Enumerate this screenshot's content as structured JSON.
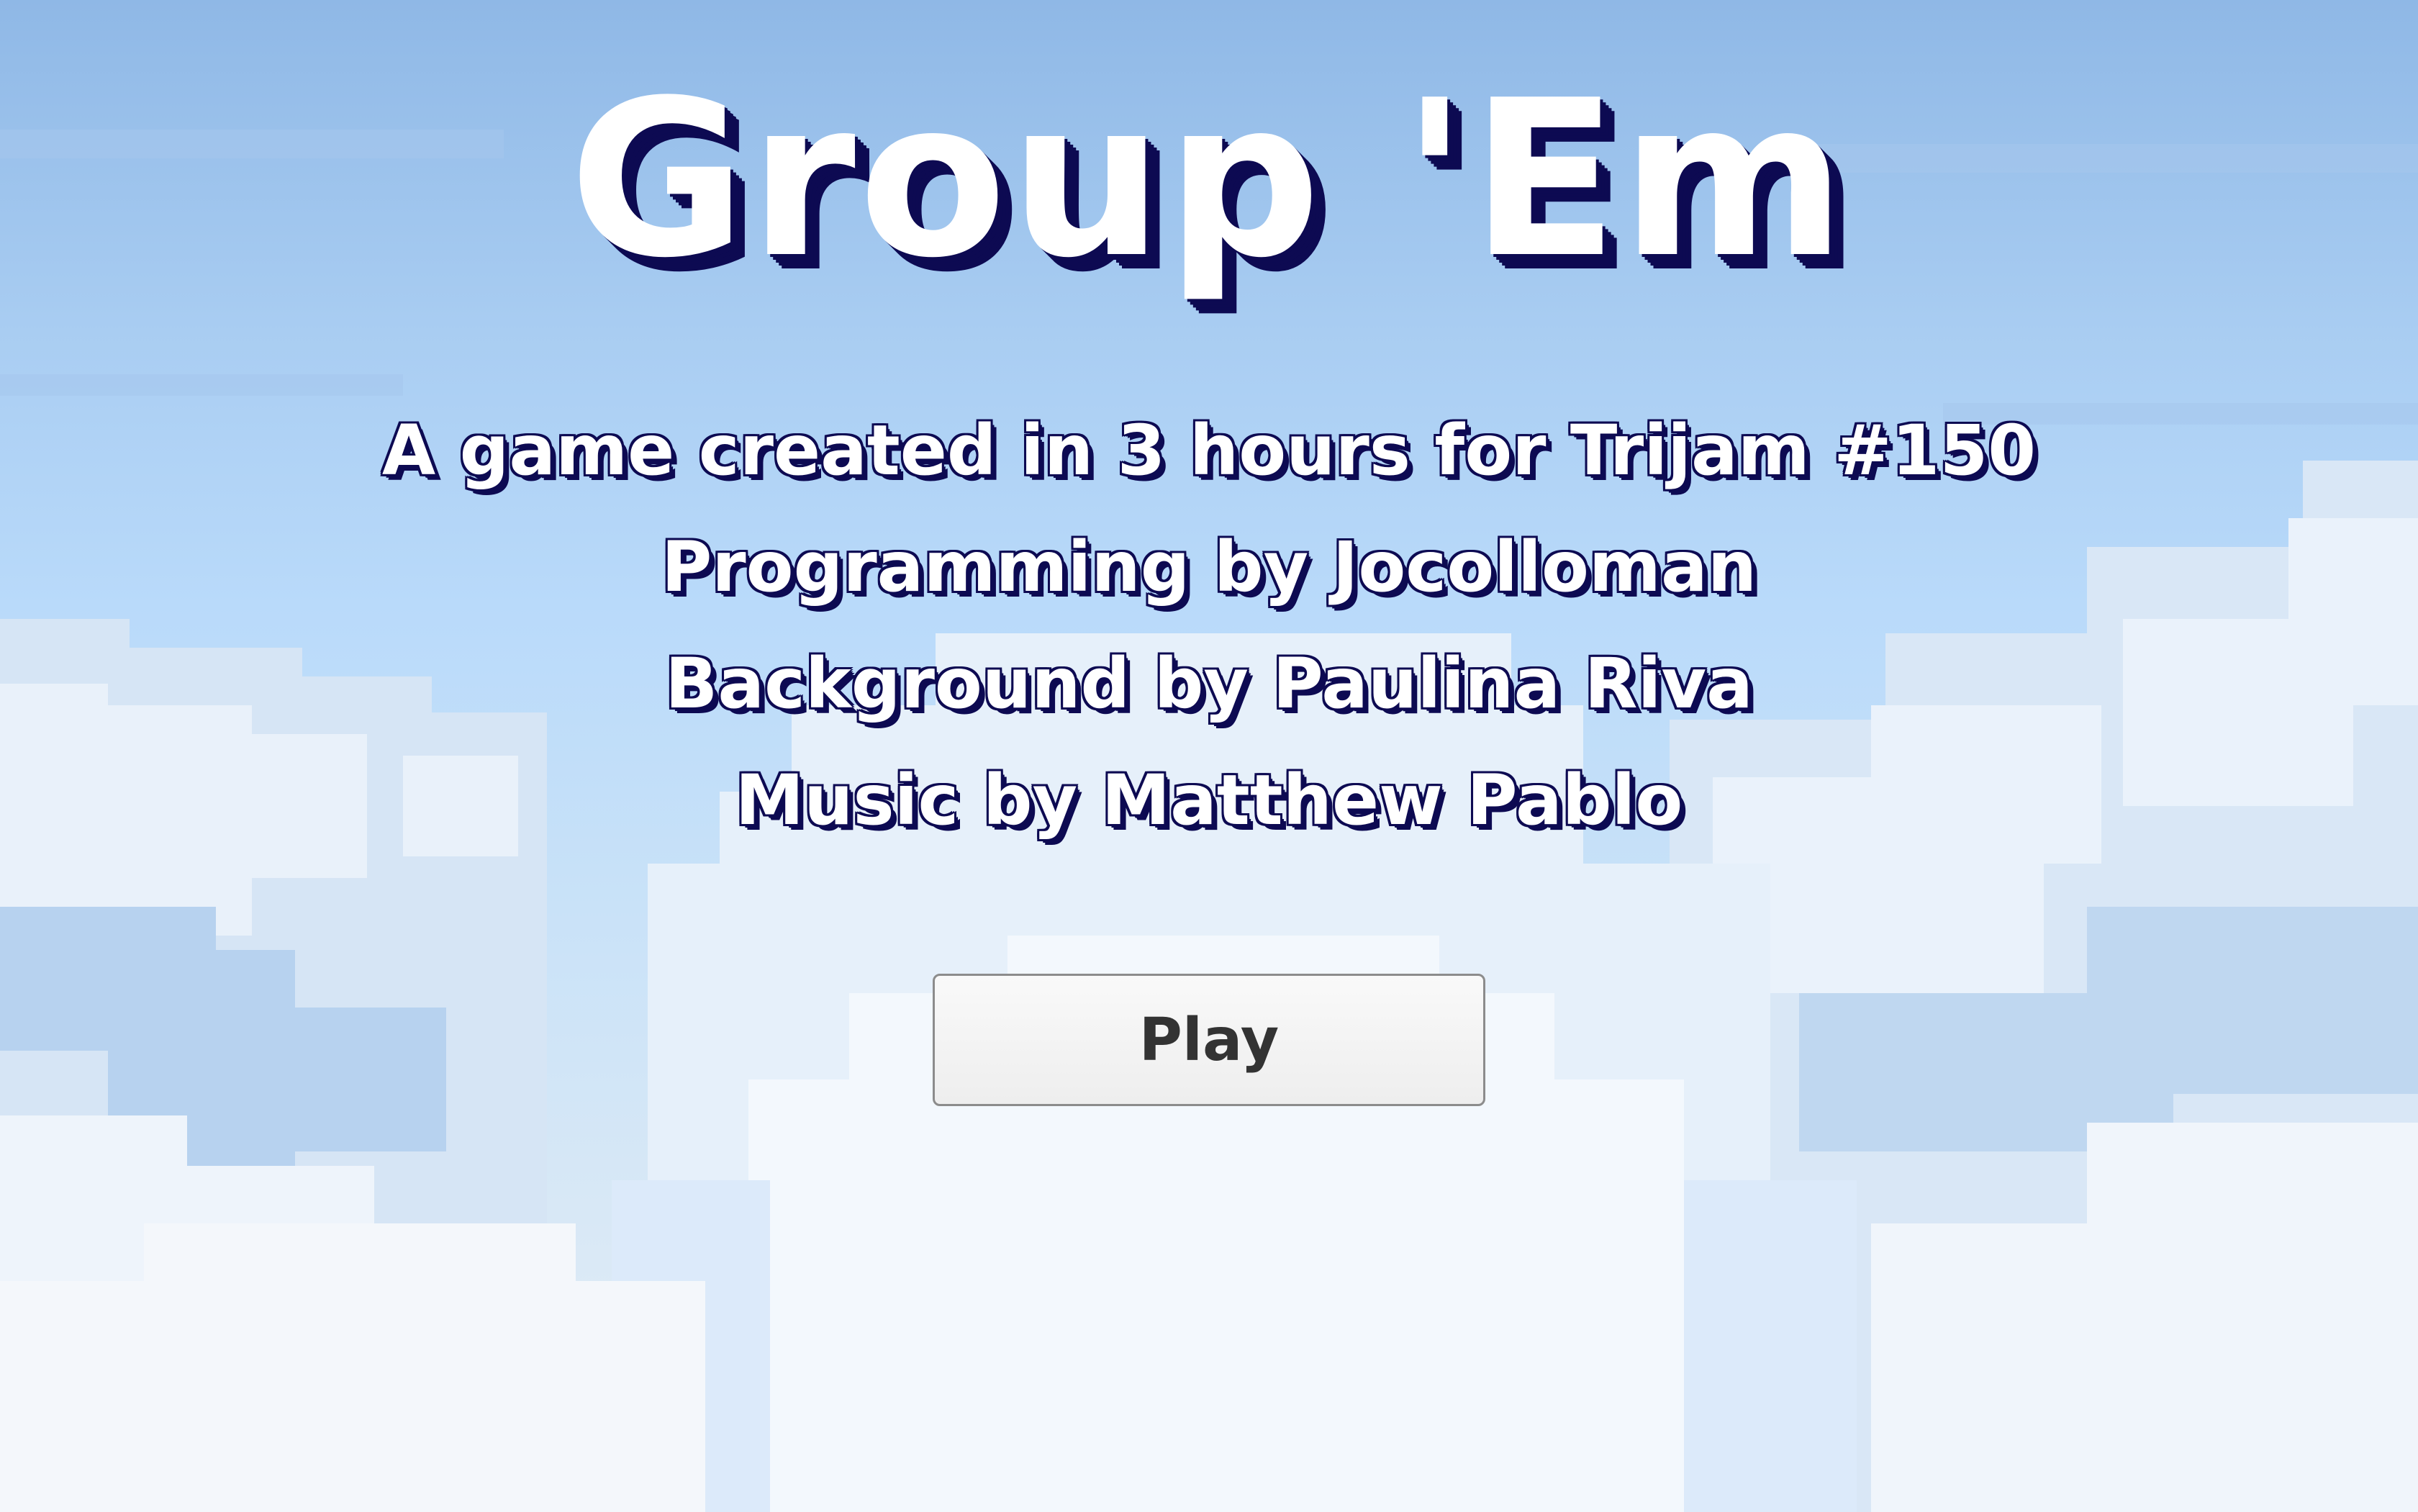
{
  "game": {
    "title": "Group 'Em",
    "credits": [
      "A game created in 3 hours for Trijam #150",
      "Programming by Jocolloman",
      "Background by Paulina Riva",
      "Music by Matthew Pablo"
    ]
  },
  "menu": {
    "play_label": "Play"
  },
  "colors": {
    "sky_top": "#8fb8e6",
    "sky_mid": "#b9dafa",
    "cloud_white": "#f2f6fb",
    "cloud_shade": "#dbe8f5",
    "text_fill": "#ffffff",
    "text_outline": "#0d0a52",
    "button_bg": "#f4f4f4",
    "button_text": "#333333"
  },
  "icons": {
    "background": "pixel-cloud-sky"
  }
}
